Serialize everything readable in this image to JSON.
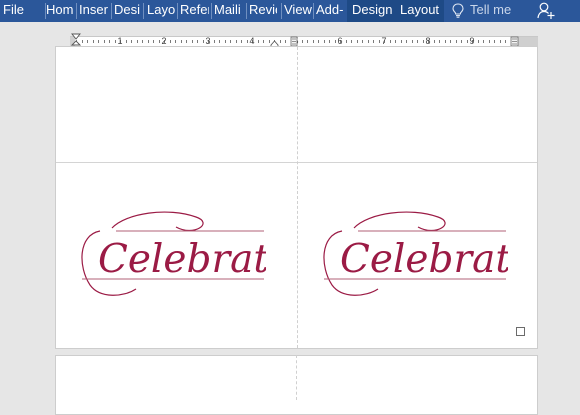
{
  "ribbon": {
    "tabs": [
      {
        "label": "File"
      },
      {
        "label": "Hom"
      },
      {
        "label": "Inser"
      },
      {
        "label": "Desig"
      },
      {
        "label": "Layo"
      },
      {
        "label": "Refer"
      },
      {
        "label": "Maili"
      },
      {
        "label": "Revie"
      },
      {
        "label": "View"
      },
      {
        "label": "Add-"
      },
      {
        "label": "Design"
      },
      {
        "label": "Layout"
      }
    ],
    "tell_me": "Tell me",
    "colors": {
      "ribbon": "#2b579a",
      "contextual": "#1e4a86"
    }
  },
  "ruler": {
    "numbers": [
      "1",
      "2",
      "3",
      "4",
      "5",
      "6",
      "7",
      "8",
      "9"
    ]
  },
  "document": {
    "cards": [
      {
        "text": "Celebrate",
        "color": "#9b1b45"
      },
      {
        "text": "Celebrate",
        "color": "#9b1b45"
      }
    ]
  }
}
